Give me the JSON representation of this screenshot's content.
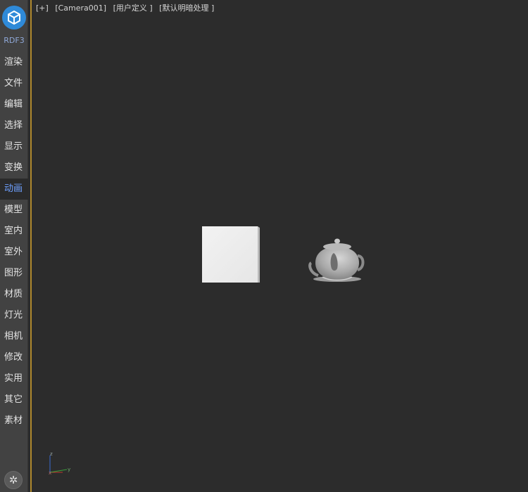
{
  "sidebar": {
    "brand": "RDF3",
    "items": [
      {
        "label": "渲染"
      },
      {
        "label": "文件"
      },
      {
        "label": "编辑"
      },
      {
        "label": "选择"
      },
      {
        "label": "显示"
      },
      {
        "label": "变换"
      },
      {
        "label": "动画",
        "active": true
      },
      {
        "label": "模型"
      },
      {
        "label": "室内"
      },
      {
        "label": "室外"
      },
      {
        "label": "图形"
      },
      {
        "label": "材质"
      },
      {
        "label": "灯光"
      },
      {
        "label": "相机"
      },
      {
        "label": "修改"
      },
      {
        "label": "实用"
      },
      {
        "label": "其它"
      },
      {
        "label": "素材"
      }
    ]
  },
  "viewport": {
    "labels": [
      "[+]",
      "[Camera001]",
      "[用户定义 ]",
      "[默认明暗处理 ]"
    ],
    "axis": {
      "z": "z",
      "x": "x",
      "y": "y"
    }
  },
  "colors": {
    "accent": "#2f8ad8",
    "active_text": "#6ea0ff",
    "viewport_border": "#b0892d",
    "axis_x": "#c0392b",
    "axis_y": "#3a9e3a",
    "axis_z": "#3a6ad0"
  }
}
